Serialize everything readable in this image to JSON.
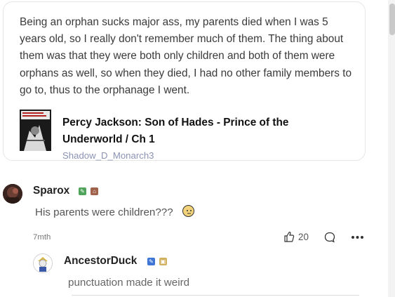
{
  "quote": {
    "text": "Being an orphan sucks major ass, my parents died when I was 5 years old, so I really don't remember much of them. The thing about them was that they were both only children and both of them were orphans as well, so when they died, I had no other family members to go to, thus to the orphanage I went.",
    "book_title": "Percy Jackson: Son of Hades - Prince of the Underworld / Ch 1",
    "book_author": "Shadow_D_Monarch3"
  },
  "comments": [
    {
      "username": "Sparox",
      "text": "His parents were children???",
      "time": "7mth",
      "likes": "20"
    },
    {
      "username": "AncestorDuck",
      "text": "punctuation made it weird"
    }
  ],
  "colors": {
    "accent": "#8b93b4",
    "badge_green": "#4fa35a",
    "badge_brown": "#a0624a",
    "badge_blue": "#3f76d6",
    "badge_gold": "#d2b160"
  },
  "icons": [
    "thumbs-up-icon",
    "comment-bubble-icon",
    "more-options-icon",
    "neutral-face-emoji-icon"
  ]
}
